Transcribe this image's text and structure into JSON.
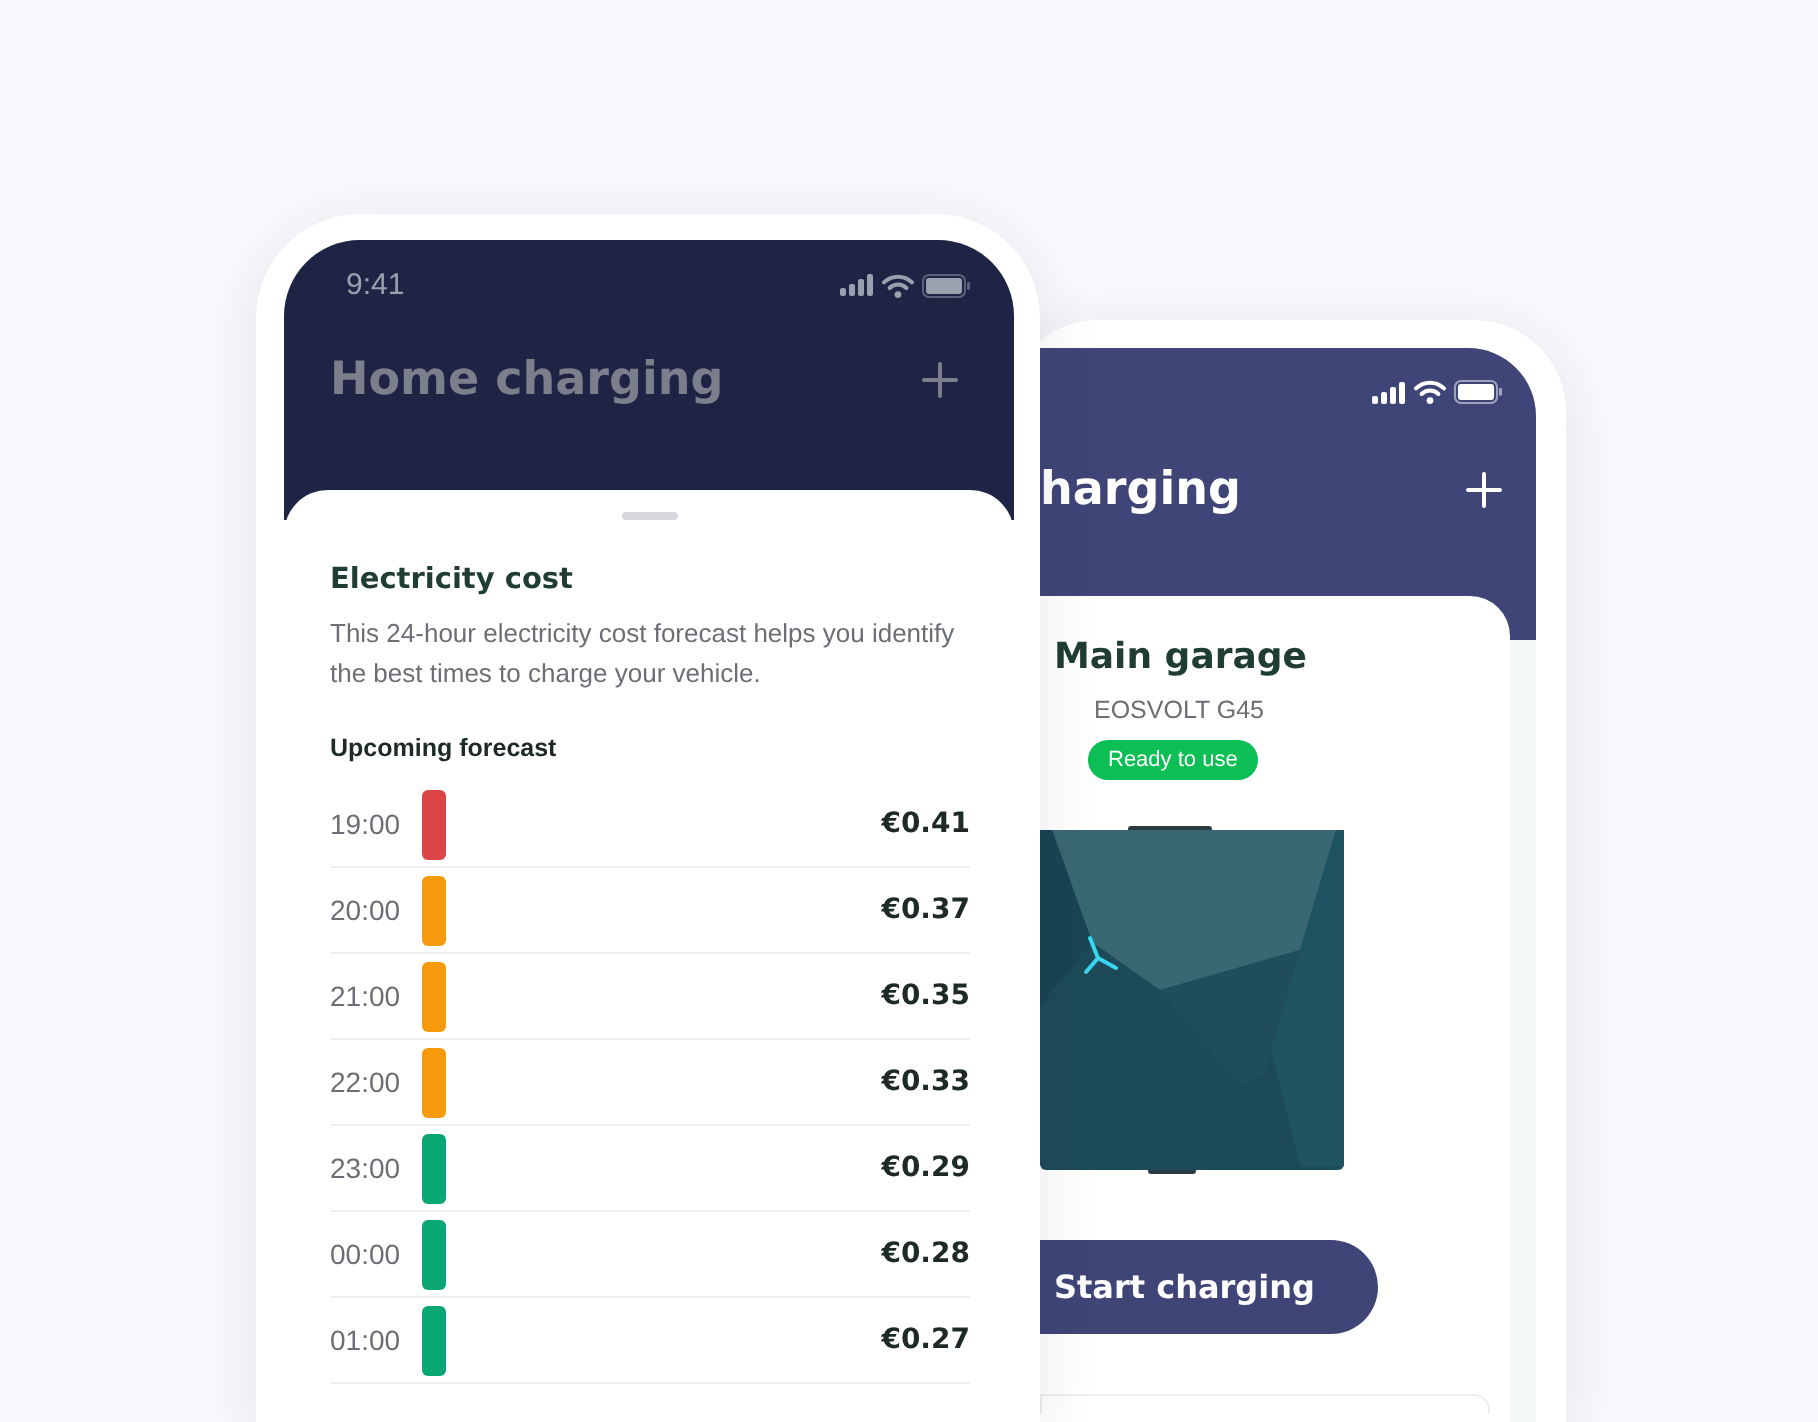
{
  "front_phone": {
    "status_time": "9:41",
    "title": "Home charging",
    "sheet": {
      "title": "Electricity cost",
      "description": "This 24-hour electricity cost forecast helps you identify the best times to charge your vehicle.",
      "section_title": "Upcoming forecast",
      "forecast": [
        {
          "time": "19:00",
          "color": "#dc4545",
          "price": "€0.41"
        },
        {
          "time": "20:00",
          "color": "#f59a0c",
          "price": "€0.37"
        },
        {
          "time": "21:00",
          "color": "#f59a0c",
          "price": "€0.35"
        },
        {
          "time": "22:00",
          "color": "#f59a0c",
          "price": "€0.33"
        },
        {
          "time": "23:00",
          "color": "#0aa673",
          "price": "€0.29"
        },
        {
          "time": "00:00",
          "color": "#0aa673",
          "price": "€0.28"
        },
        {
          "time": "01:00",
          "color": "#0aa673",
          "price": "€0.27"
        }
      ]
    }
  },
  "back_phone": {
    "title": "harging",
    "charger": {
      "name": "Main garage",
      "model": "EOSVOLT G45",
      "status": "Ready to use"
    },
    "button": "Start charging"
  }
}
